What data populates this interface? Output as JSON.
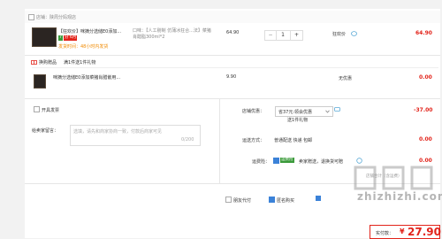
{
  "shop": {
    "label": "店铺：陕周分妈观店"
  },
  "item1": {
    "title": "【狂欢价】咪摘分选储E0添加...",
    "badge_a": "7",
    "badge_b": "分",
    "badge_c": "6月",
    "delivery": "发货时间：48小时内发货",
    "spec": "口味：【人工剔制 仿蒲冰狂合...法】菜猪肖醋脂300ml*2",
    "price": "64.90",
    "qty": "1",
    "qty_minus": "−",
    "qty_plus": "+",
    "promo": "狂欢价",
    "subtotal": "64.90"
  },
  "gift": {
    "section_label": "换购赠品",
    "rule": "满1件送1件礼物",
    "title": "咪摘分选储E0添加菜猪肖腊嵌用...",
    "price": "9.90",
    "promo": "无优惠",
    "subtotal": "0.00"
  },
  "invoice": {
    "label": "开具发票"
  },
  "discount": {
    "label": "店铺优惠：",
    "selected": "省37元:领会优惠",
    "sub": "送1件礼物",
    "amount": "-37.00"
  },
  "message": {
    "label": "给卖家留言：",
    "placeholder": "选填，请先和商家协商一致，付款后商家可见",
    "counter": "0/200"
  },
  "shipping": {
    "label": "运送方式：",
    "value": "普通配送 快递 包邮",
    "amount": "0.00"
  },
  "insurance": {
    "label": "运费险：",
    "badge": "运费险",
    "text": "卖家赠送，退换货可赔",
    "amount": "0.00"
  },
  "options": {
    "anonymous": "匿名购买",
    "friend_pay": "朋友代付"
  },
  "total": {
    "label": "实付款：",
    "currency": "¥",
    "amount": "27.90"
  },
  "watermark": {
    "text": "值|么|得",
    "site": "zhizhizhi.com",
    "extra": "店铺合计（含运费）"
  }
}
